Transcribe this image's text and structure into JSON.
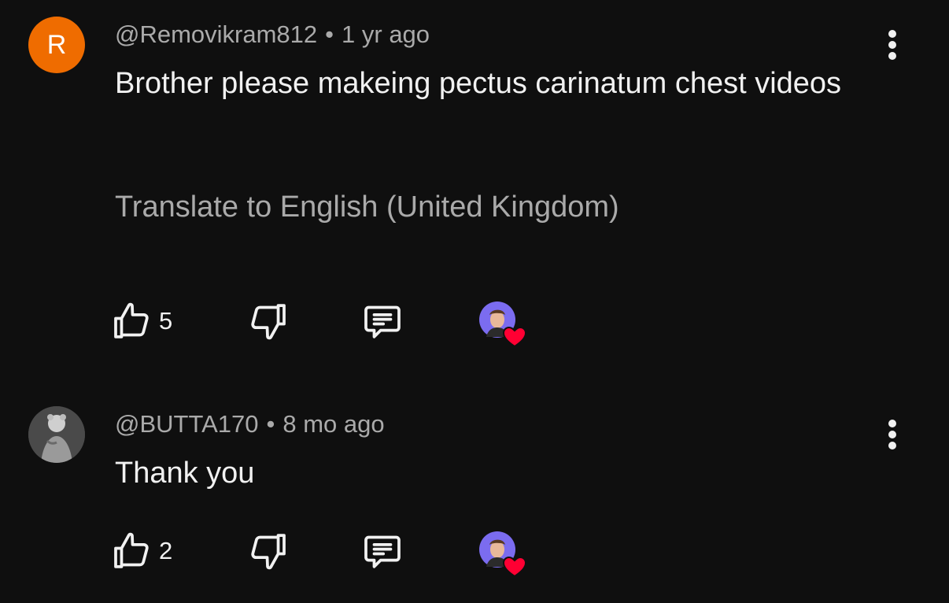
{
  "comments": [
    {
      "avatar_letter": "R",
      "author": "@Removikram812",
      "separator": "•",
      "time": "1 yr ago",
      "text": "Brother please makeing pectus carinatum chest videos",
      "translate_label": "Translate to English (United Kingdom)",
      "like_count": "5"
    },
    {
      "author": "@BUTTA170",
      "separator": "•",
      "time": "8 mo ago",
      "text": "Thank you",
      "like_count": "2"
    }
  ],
  "icons": {
    "more": "more-vertical-icon",
    "like": "thumb-up-icon",
    "dislike": "thumb-down-icon",
    "reply": "reply-comment-icon",
    "creator_heart": "creator-heart-icon"
  },
  "colors": {
    "background": "#0f0f0f",
    "primary_text": "#f1f1f1",
    "secondary_text": "#aaaaaa",
    "avatar_orange": "#ef6c00",
    "heart_red": "#ff0033",
    "creator_avatar_bg": "#7b6cf0"
  }
}
